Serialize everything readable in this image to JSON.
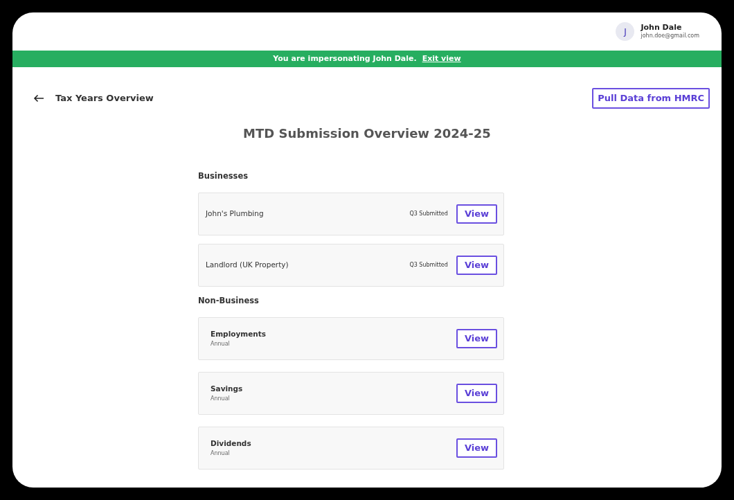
{
  "user": {
    "initial": "J",
    "name": "John Dale",
    "email": "john.doe@gmail.com"
  },
  "banner": {
    "message": "You are impersonating John Dale.",
    "link": "Exit view"
  },
  "back": {
    "label": "Tax Years Overview"
  },
  "pull_button": "Pull Data from HMRC",
  "title": "MTD Submission Overview 2024-25",
  "sections": [
    {
      "heading": "Businesses",
      "items": [
        {
          "kind": "business",
          "name": "John's Plumbing",
          "status": "Q3 Submitted",
          "action": "View"
        },
        {
          "kind": "business",
          "name": "Landlord (UK Property)",
          "status": "Q3 Submitted",
          "action": "View"
        }
      ]
    },
    {
      "heading": "Non-Business",
      "items": [
        {
          "kind": "annual",
          "name": "Employments",
          "subtitle": "Annual",
          "action": "View"
        },
        {
          "kind": "annual",
          "name": "Savings",
          "subtitle": "Annual",
          "action": "View"
        },
        {
          "kind": "annual",
          "name": "Dividends",
          "subtitle": "Annual",
          "action": "View"
        }
      ]
    }
  ]
}
